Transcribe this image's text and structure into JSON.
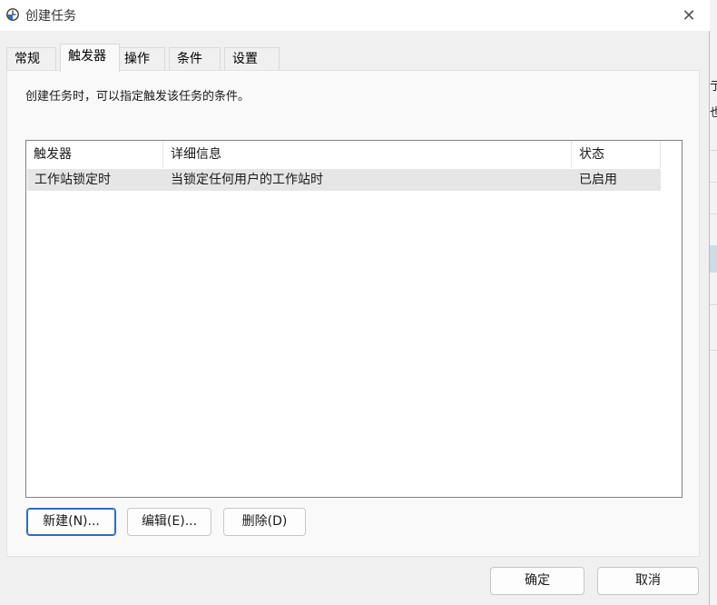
{
  "window": {
    "title": "创建任务",
    "close_glyph": "✕"
  },
  "tabs": [
    {
      "label": "常规"
    },
    {
      "label": "触发器"
    },
    {
      "label": "操作"
    },
    {
      "label": "条件"
    },
    {
      "label": "设置"
    }
  ],
  "active_tab": "触发器",
  "triggers_panel": {
    "description": "创建任务时，可以指定触发该任务的条件。",
    "columns": [
      "触发器",
      "详细信息",
      "状态"
    ],
    "rows": [
      {
        "trigger": "工作站锁定时",
        "details": "当锁定任何用户的工作站时",
        "status": "已启用"
      }
    ],
    "buttons": {
      "new": "新建(N)...",
      "edit": "编辑(E)...",
      "delete": "删除(D)"
    }
  },
  "footer": {
    "ok": "确定",
    "cancel": "取消"
  },
  "background_fragments": [
    "亍",
    "也"
  ],
  "colors": {
    "default_button_border": "#2b6cc4",
    "selected_row": "#e6e6e6"
  }
}
